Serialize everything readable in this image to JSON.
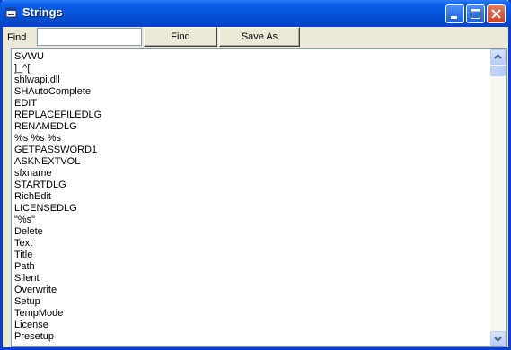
{
  "window": {
    "title": "Strings"
  },
  "toolbar": {
    "find_label": "Find",
    "find_value": "",
    "find_button": "Find",
    "save_as_button": "Save As"
  },
  "strings": [
    "SVWU",
    "]_^[",
    "shlwapi.dll",
    "SHAutoComplete",
    "EDIT",
    "REPLACEFILEDLG",
    "RENAMEDLG",
    "%s %s %s",
    "GETPASSWORD1",
    "ASKNEXTVOL",
    "sfxname",
    "STARTDLG",
    "RichEdit",
    "LICENSEDLG",
    "\"%s\"",
    "Delete",
    "Text",
    "Title",
    "Path",
    "Silent",
    "Overwrite",
    "Setup",
    "TempMode",
    "License",
    "Presetup"
  ]
}
